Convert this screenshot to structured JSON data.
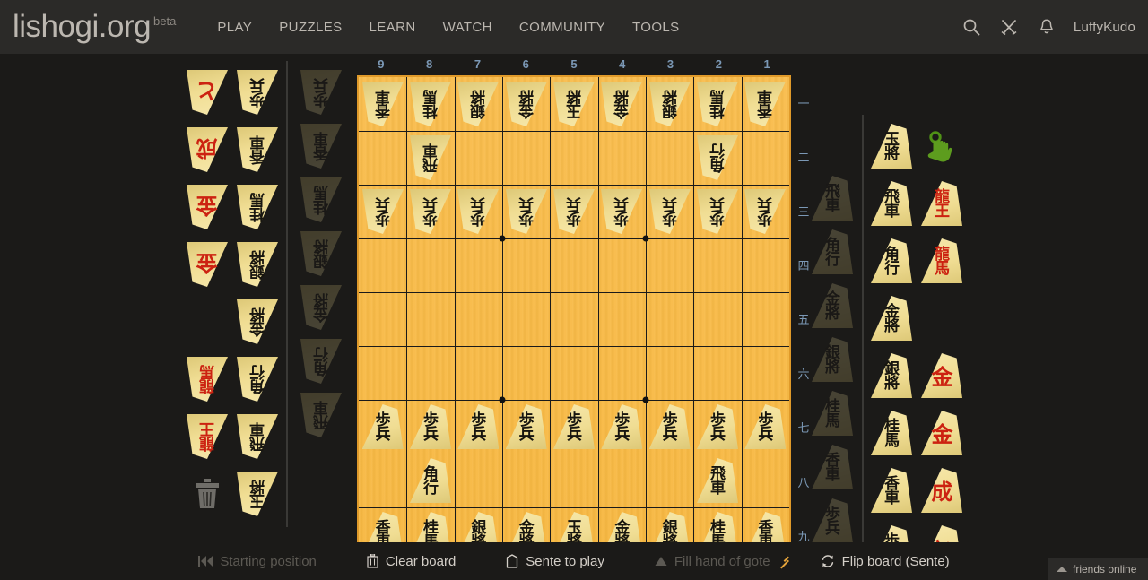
{
  "header": {
    "brand": "lishogi.org",
    "beta": "beta",
    "nav": [
      "PLAY",
      "PUZZLES",
      "LEARN",
      "WATCH",
      "COMMUNITY",
      "TOOLS"
    ],
    "icons": [
      "search-icon",
      "challenge-swords-icon",
      "notification-bell-icon"
    ],
    "username": "LuffyKudo"
  },
  "board": {
    "files": [
      "9",
      "8",
      "7",
      "6",
      "5",
      "4",
      "3",
      "2",
      "1"
    ],
    "ranks": [
      "一",
      "二",
      "三",
      "四",
      "五",
      "六",
      "七",
      "八",
      "九"
    ],
    "colors": {
      "wood": "#f9bd4e",
      "border": "#e09a2a",
      "grid": "#1a1a1a",
      "coords": "#7b98b5"
    },
    "squares": [
      [
        {
          "p": "lance",
          "s": "gote"
        },
        {
          "p": "knight",
          "s": "gote"
        },
        {
          "p": "silver",
          "s": "gote"
        },
        {
          "p": "gold",
          "s": "gote"
        },
        {
          "p": "king",
          "s": "gote"
        },
        {
          "p": "gold",
          "s": "gote"
        },
        {
          "p": "silver",
          "s": "gote"
        },
        {
          "p": "knight",
          "s": "gote"
        },
        {
          "p": "lance",
          "s": "gote"
        }
      ],
      [
        null,
        {
          "p": "rook",
          "s": "gote"
        },
        null,
        null,
        null,
        null,
        null,
        {
          "p": "bishop",
          "s": "gote"
        },
        null
      ],
      [
        {
          "p": "pawn",
          "s": "gote"
        },
        {
          "p": "pawn",
          "s": "gote"
        },
        {
          "p": "pawn",
          "s": "gote"
        },
        {
          "p": "pawn",
          "s": "gote"
        },
        {
          "p": "pawn",
          "s": "gote"
        },
        {
          "p": "pawn",
          "s": "gote"
        },
        {
          "p": "pawn",
          "s": "gote"
        },
        {
          "p": "pawn",
          "s": "gote"
        },
        {
          "p": "pawn",
          "s": "gote"
        }
      ],
      [
        null,
        null,
        null,
        null,
        null,
        null,
        null,
        null,
        null
      ],
      [
        null,
        null,
        null,
        null,
        null,
        null,
        null,
        null,
        null
      ],
      [
        null,
        null,
        null,
        null,
        null,
        null,
        null,
        null,
        null
      ],
      [
        {
          "p": "pawn",
          "s": "sente"
        },
        {
          "p": "pawn",
          "s": "sente"
        },
        {
          "p": "pawn",
          "s": "sente"
        },
        {
          "p": "pawn",
          "s": "sente"
        },
        {
          "p": "pawn",
          "s": "sente"
        },
        {
          "p": "pawn",
          "s": "sente"
        },
        {
          "p": "pawn",
          "s": "sente"
        },
        {
          "p": "pawn",
          "s": "sente"
        },
        {
          "p": "pawn",
          "s": "sente"
        }
      ],
      [
        null,
        {
          "p": "bishop",
          "s": "sente"
        },
        null,
        null,
        null,
        null,
        null,
        {
          "p": "rook",
          "s": "sente"
        },
        null
      ],
      [
        {
          "p": "lance",
          "s": "sente"
        },
        {
          "p": "knight",
          "s": "sente"
        },
        {
          "p": "silver",
          "s": "sente"
        },
        {
          "p": "gold",
          "s": "sente"
        },
        {
          "p": "king",
          "s": "sente"
        },
        {
          "p": "gold",
          "s": "sente"
        },
        {
          "p": "silver",
          "s": "sente"
        },
        {
          "p": "knight",
          "s": "sente"
        },
        {
          "p": "lance",
          "s": "sente"
        }
      ]
    ]
  },
  "pieces": {
    "king": {
      "kanji": "玉將",
      "lines": 2
    },
    "rook": {
      "kanji": "飛車",
      "lines": 2
    },
    "bishop": {
      "kanji": "角行",
      "lines": 2
    },
    "gold": {
      "kanji": "金將",
      "lines": 2
    },
    "silver": {
      "kanji": "銀將",
      "lines": 2
    },
    "knight": {
      "kanji": "桂馬",
      "lines": 2
    },
    "lance": {
      "kanji": "香車",
      "lines": 2
    },
    "pawn": {
      "kanji": "歩兵",
      "lines": 2
    },
    "dragon": {
      "kanji": "龍王",
      "lines": 2
    },
    "horse": {
      "kanji": "龍馬",
      "lines": 2
    },
    "pgold": {
      "kanji": "金",
      "lines": 1
    },
    "plance": {
      "kanji": "成",
      "lines": 1
    },
    "tokin": {
      "kanji": "と",
      "lines": 1
    }
  },
  "spare_gote": {
    "label": "gote-spare-palette",
    "rows": [
      {
        "promoted": "tokin",
        "plain": "pawn"
      },
      {
        "promoted": "plance",
        "plain": "lance"
      },
      {
        "promoted": "pgold",
        "plain": "knight"
      },
      {
        "promoted": "pgold",
        "plain": "silver"
      },
      {
        "promoted": null,
        "plain": "gold"
      },
      {
        "promoted": "horse",
        "plain": "bishop"
      },
      {
        "promoted": "dragon",
        "plain": "rook"
      },
      {
        "promoted": "trash",
        "plain": "king"
      }
    ]
  },
  "spare_sente": {
    "label": "sente-spare-palette",
    "rows": [
      {
        "plain": "king",
        "promoted": "cursor"
      },
      {
        "plain": "rook",
        "promoted": "dragon"
      },
      {
        "plain": "bishop",
        "promoted": "horse"
      },
      {
        "plain": "gold",
        "promoted": null
      },
      {
        "plain": "silver",
        "promoted": "pgold"
      },
      {
        "plain": "knight",
        "promoted": "pgold"
      },
      {
        "plain": "lance",
        "promoted": "plance"
      },
      {
        "plain": "pawn",
        "promoted": "tokin"
      }
    ]
  },
  "hand_gote": [
    "pawn",
    "lance",
    "knight",
    "silver",
    "gold",
    "bishop",
    "rook"
  ],
  "hand_sente": [
    "rook",
    "bishop",
    "gold",
    "silver",
    "knight",
    "lance",
    "pawn"
  ],
  "toolbar": [
    {
      "label": "Starting position",
      "icon": "rewind-icon",
      "disabled": true
    },
    {
      "label": "Clear board",
      "icon": "trash-icon",
      "disabled": false
    },
    {
      "label": "Sente to play",
      "icon": "pawn-outline-icon",
      "disabled": false
    },
    {
      "label": "Fill hand of gote",
      "icon": "triangle-up-icon",
      "disabled": true
    },
    {
      "label": "Flip board (Sente)",
      "icon": "flip-icon",
      "disabled": false
    }
  ],
  "friends": {
    "label": "friends online",
    "icon": "caret-up-icon"
  }
}
